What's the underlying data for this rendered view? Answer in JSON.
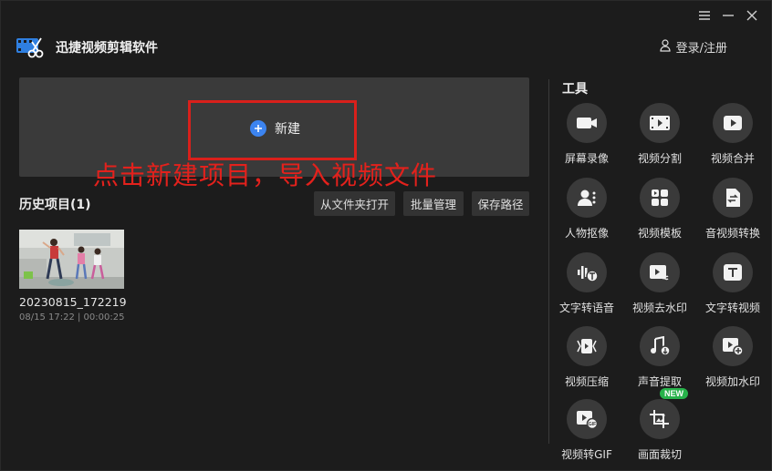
{
  "window": {
    "title": "迅捷视频剪辑软件"
  },
  "header": {
    "login_label": "登录/注册"
  },
  "new_project": {
    "label": "新建"
  },
  "annotation": {
    "text": "点击新建项目，导入视频文件"
  },
  "history": {
    "title": "历史项目(1)",
    "buttons": [
      "从文件夹打开",
      "批量管理",
      "保存路径"
    ],
    "projects": [
      {
        "name": "20230815_172219",
        "meta": "08/15 17:22 | 00:00:25"
      }
    ]
  },
  "tools": {
    "title": "工具",
    "items": [
      {
        "label": "屏幕录像",
        "icon": "camera-icon"
      },
      {
        "label": "视频分割",
        "icon": "film-split-icon"
      },
      {
        "label": "视频合并",
        "icon": "video-merge-icon"
      },
      {
        "label": "人物抠像",
        "icon": "person-cutout-icon"
      },
      {
        "label": "视频模板",
        "icon": "template-icon"
      },
      {
        "label": "音视频转换",
        "icon": "convert-icon"
      },
      {
        "label": "文字转语音",
        "icon": "text-to-speech-icon"
      },
      {
        "label": "视频去水印",
        "icon": "remove-watermark-icon"
      },
      {
        "label": "文字转视频",
        "icon": "text-to-video-icon"
      },
      {
        "label": "视频压缩",
        "icon": "compress-icon"
      },
      {
        "label": "声音提取",
        "icon": "audio-extract-icon"
      },
      {
        "label": "视频加水印",
        "icon": "add-watermark-icon"
      },
      {
        "label": "视频转GIF",
        "icon": "gif-icon"
      },
      {
        "label": "画面裁切",
        "icon": "crop-icon",
        "badge": "NEW"
      }
    ]
  },
  "colors": {
    "background": "#1c1c1c",
    "panel": "#3a3a3a",
    "accent": "#3c84f0",
    "annotation": "#e3211c",
    "badge": "#27b24a"
  }
}
